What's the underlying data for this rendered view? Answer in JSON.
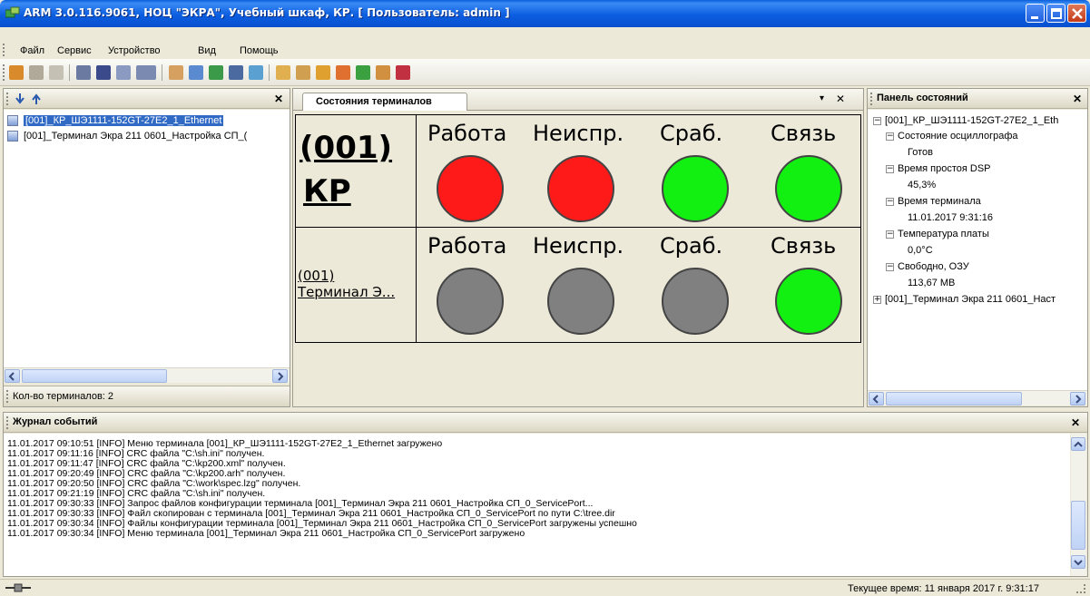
{
  "window": {
    "title": "ARM 3.0.116.9061, НОЦ \"ЭКРА\", Учебный шкаф, КР. [ Пользователь: admin ]"
  },
  "menu": [
    "Файл",
    "Сервис",
    "Устройство",
    "Вид",
    "Помощь"
  ],
  "toolbar_icons": [
    "connect-icon",
    "users-icon",
    "list-icon",
    "grid-icon",
    "window-icon",
    "split-icon",
    "monitor-icon",
    "chart-icon",
    "table-icon",
    "network-icon",
    "filter-icon",
    "gear-icon",
    "folder-open-icon",
    "edit-icon",
    "save-icon",
    "report-icon",
    "chart-green-icon",
    "settings-icon",
    "export-icon"
  ],
  "left_panel": {
    "items": [
      {
        "label": "[001]_КР_ШЭ1111-152GT-27E2_1_Ethernet",
        "selected": true
      },
      {
        "label": "[001]_Терминал Экра 211 0601_Настройка СП_(",
        "selected": false
      }
    ],
    "count_label": "Кол-во терминалов: 2"
  },
  "center_panel": {
    "tab_label": "Состояния терминалов",
    "rows": [
      {
        "name_line1": "(001)",
        "name_line2": "КР",
        "labels": [
          "Работа",
          "Неиспр.",
          "Сраб.",
          "Связь"
        ],
        "states": [
          "red",
          "red",
          "green",
          "green"
        ]
      },
      {
        "name_line1": "(001)",
        "name_line2": "Терминал Э...",
        "labels": [
          "Работа",
          "Неиспр.",
          "Сраб.",
          "Связь"
        ],
        "states": [
          "gray",
          "gray",
          "gray",
          "green"
        ]
      }
    ]
  },
  "colors": {
    "red": "#ff1a1a",
    "green": "#12f012",
    "gray": "#808080",
    "selection": "#316ac5"
  },
  "right_panel": {
    "title": "Панель состояний",
    "root1": "[001]_КР_ШЭ1111-152GT-27E2_1_Eth",
    "nodes": [
      {
        "name": "Состояние осциллографа",
        "value": "Готов"
      },
      {
        "name": "Время простоя DSP",
        "value": "45,3%"
      },
      {
        "name": "Время терминала",
        "value": "11.01.2017 9:31:16"
      },
      {
        "name": "Температура платы",
        "value": "0,0°C"
      },
      {
        "name": "Свободно, ОЗУ",
        "value": "113,67 MB"
      }
    ],
    "root2": "[001]_Терминал Экра 211 0601_Наст"
  },
  "log": {
    "title": "Журнал событий",
    "lines": [
      "11.01.2017 09:10:51 [INFO] Меню терминала [001]_КР_ШЭ1111-152GT-27E2_1_Ethernet загружено",
      "11.01.2017 09:11:16 [INFO] CRC файла \"C:\\sh.ini\" получен.",
      "11.01.2017 09:11:47 [INFO] CRC файла \"C:\\kp200.xml\" получен.",
      "11.01.2017 09:20:49 [INFO] CRC файла \"C:\\kp200.arh\" получен.",
      "11.01.2017 09:20:50 [INFO] CRC файла \"C:\\work\\spec.lzg\" получен.",
      "11.01.2017 09:21:19 [INFO] CRC файла \"C:\\sh.ini\" получен.",
      "11.01.2017 09:30:33 [INFO] Запрос файлов конфигурации терминала [001]_Терминал Экра 211 0601_Настройка СП_0_ServicePort...",
      "11.01.2017 09:30:33 [INFO] Файл скопирован с терминала [001]_Терминал Экра 211 0601_Настройка СП_0_ServicePort по пути C:\\tree.dir",
      "11.01.2017 09:30:34 [INFO] Файлы конфигурации терминала [001]_Терминал Экра 211 0601_Настройка СП_0_ServicePort загружены успешно",
      "11.01.2017 09:30:34 [INFO] Меню терминала [001]_Терминал Экра 211 0601_Настройка СП_0_ServicePort загружено"
    ]
  },
  "statusbar": {
    "time_text": "Текущее время: 11 января 2017 г. 9:31:17"
  }
}
